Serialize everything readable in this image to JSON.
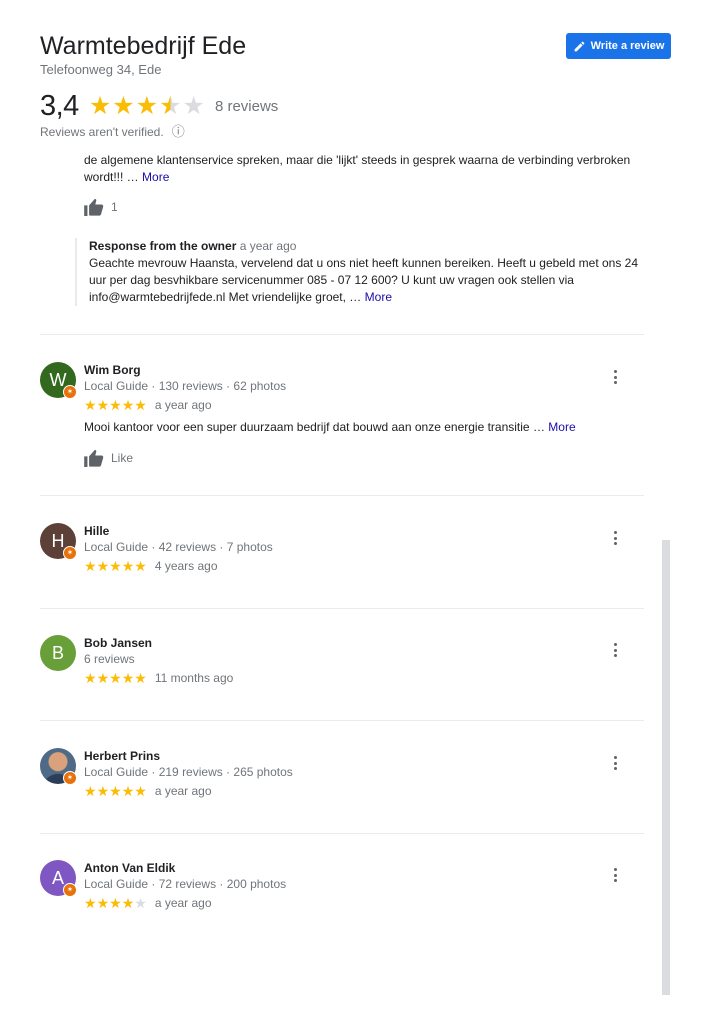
{
  "business": {
    "name": "Warmtebedrijf Ede",
    "address": "Telefoonweg 34, Ede",
    "write_review_label": "Write a review"
  },
  "summary": {
    "rating": "3,4",
    "rating_value": 3.4,
    "reviews_count": "8 reviews",
    "verified_note": "Reviews aren't verified.",
    "info_icon": "ⓘ"
  },
  "previous_review": {
    "text_end": "de algemene klantenservice spreken, maar die 'lijkt' steeds in gesprek waarna de verbinding verbroken wordt!!! …",
    "more_label": "More",
    "like_count": "1",
    "owner_response": {
      "label": "Response from the owner",
      "time": "a year ago",
      "text": "Geachte mevrouw Haansta, vervelend dat u ons niet heeft kunnen bereiken. Heeft u gebeld met ons 24 uur per dag besvhikbare servicenummer 085 - 07 12 600? U kunt uw vragen ook stellen via info@warmtebedrijfede.nl Met vriendelijke groet, …",
      "more_label": "More"
    }
  },
  "reviews": [
    {
      "initial": "W",
      "avatar_color": "#33691e",
      "guide": true,
      "name": "Wim Borg",
      "meta": "Local Guide · 130 reviews · 62 photos",
      "stars": 5,
      "time": "a year ago",
      "text": "Mooi kantoor voor een super duurzaam bedrijf dat bouwd aan onze energie transitie …",
      "more_label": "More",
      "like_label": "Like"
    },
    {
      "initial": "H",
      "avatar_color": "#5d4037",
      "guide": true,
      "name": "Hille",
      "meta": "Local Guide · 42 reviews · 7 photos",
      "stars": 5,
      "time": "4 years ago"
    },
    {
      "initial": "B",
      "avatar_color": "#689f38",
      "guide": false,
      "name": "Bob Jansen",
      "meta": "6 reviews",
      "stars": 5,
      "time": "11 months ago"
    },
    {
      "initial": "",
      "avatar_color": "#4e6a86",
      "guide": true,
      "name": "Herbert Prins",
      "meta": "Local Guide · 219 reviews · 265 photos",
      "stars": 5,
      "time": "a year ago"
    },
    {
      "initial": "A",
      "avatar_color": "#7e57c2",
      "guide": true,
      "name": "Anton Van Eldik",
      "meta": "Local Guide · 72 reviews · 200 photos",
      "stars": 4,
      "time": "a year ago"
    }
  ],
  "icons": {
    "star": "★",
    "guide_badge": "✶",
    "pencil": "pencil-icon",
    "thumb": "thumbs-up-icon",
    "more": "more-vert-icon"
  },
  "colors": {
    "accent": "#1a73e8",
    "star": "#fbbc04",
    "star_off": "#dadce0",
    "link": "#1a0dab",
    "guide_badge": "#e8710a"
  }
}
